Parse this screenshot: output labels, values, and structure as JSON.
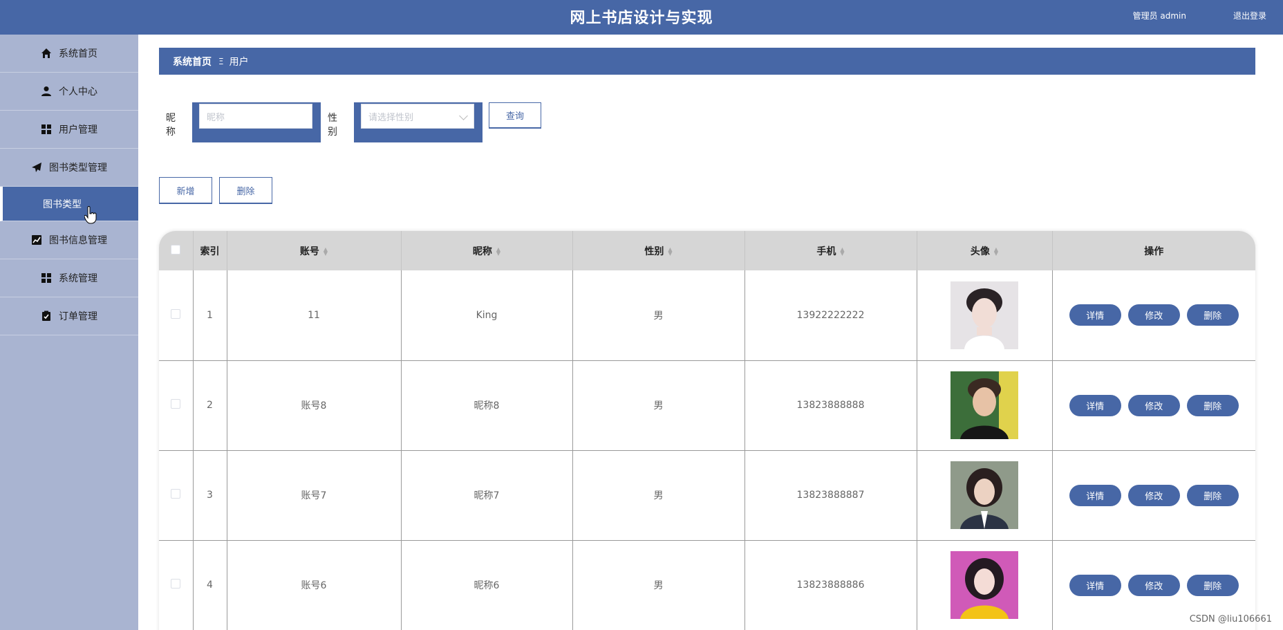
{
  "header": {
    "title": "网上书店设计与实现",
    "user": "管理员 admin",
    "logout": "退出登录"
  },
  "sidebar": {
    "items": [
      {
        "label": "系统首页",
        "icon": "home-icon"
      },
      {
        "label": "个人中心",
        "icon": "person-icon"
      },
      {
        "label": "用户管理",
        "icon": "grid-icon"
      },
      {
        "label": "图书类型管理",
        "icon": "paper-plane-icon"
      },
      {
        "label": "图书类型",
        "icon": "",
        "active": true
      },
      {
        "label": "图书信息管理",
        "icon": "chart-icon"
      },
      {
        "label": "系统管理",
        "icon": "grid-icon"
      },
      {
        "label": "订单管理",
        "icon": "clipboard-icon"
      }
    ]
  },
  "breadcrumb": {
    "home": "系统首页",
    "separator": "Ξ",
    "current": "用户"
  },
  "filters": {
    "nickname_label": "昵称",
    "nickname_placeholder": "昵称",
    "gender_label": "性别",
    "gender_placeholder": "请选择性别",
    "search_button": "查询"
  },
  "actions": {
    "add": "新增",
    "delete": "删除"
  },
  "table": {
    "columns": [
      "索引",
      "账号",
      "昵称",
      "性别",
      "手机",
      "头像",
      "操作"
    ],
    "rows": [
      {
        "index": "1",
        "account": "11",
        "nickname": "King",
        "gender": "男",
        "phone": "13922222222"
      },
      {
        "index": "2",
        "account": "账号8",
        "nickname": "昵称8",
        "gender": "男",
        "phone": "13823888888"
      },
      {
        "index": "3",
        "account": "账号7",
        "nickname": "昵称7",
        "gender": "男",
        "phone": "13823888887"
      },
      {
        "index": "4",
        "account": "账号6",
        "nickname": "昵称6",
        "gender": "男",
        "phone": "13823888886"
      }
    ],
    "row_actions": {
      "detail": "详情",
      "edit": "修改",
      "delete": "删除"
    }
  },
  "watermark": "CSDN @liu106661",
  "colors": {
    "primary": "#4767a6",
    "sidebar": "#a9b4d1",
    "header_row": "#d6d6d6"
  }
}
